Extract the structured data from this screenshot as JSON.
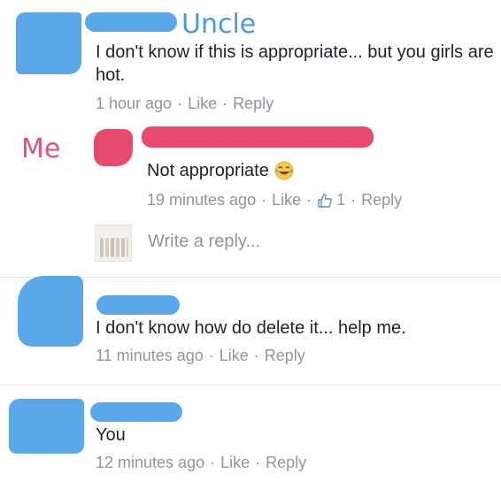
{
  "colors": {
    "redaction_blue": "#5aa7ea",
    "redaction_pink": "#e8496f",
    "label_blue": "#4a98e2",
    "label_pink": "#d9557a",
    "meta_gray": "#90949c",
    "text_dark": "#1d2129"
  },
  "comments": [
    {
      "annotation": "Uncle",
      "text": "I don't know if this is appropriate... but you girls are hot.",
      "time": "1 hour ago",
      "like": "Like",
      "reply": "Reply"
    },
    {
      "annotation": "Me",
      "text": "Not appropriate",
      "emoji": "😂",
      "time": "19 minutes ago",
      "like": "Like",
      "like_count": "1",
      "reply": "Reply"
    },
    {
      "text": "I don't know how do delete it... help me.",
      "time": "11 minutes ago",
      "like": "Like",
      "reply": "Reply"
    },
    {
      "text": "You",
      "time": "12 minutes ago",
      "like": "Like",
      "reply": "Reply"
    }
  ],
  "reply_box": {
    "placeholder": "Write a reply..."
  },
  "icons": {
    "thumbs_up": "thumbs-up-icon",
    "laughing_emoji": "laughing-emoji-icon"
  }
}
